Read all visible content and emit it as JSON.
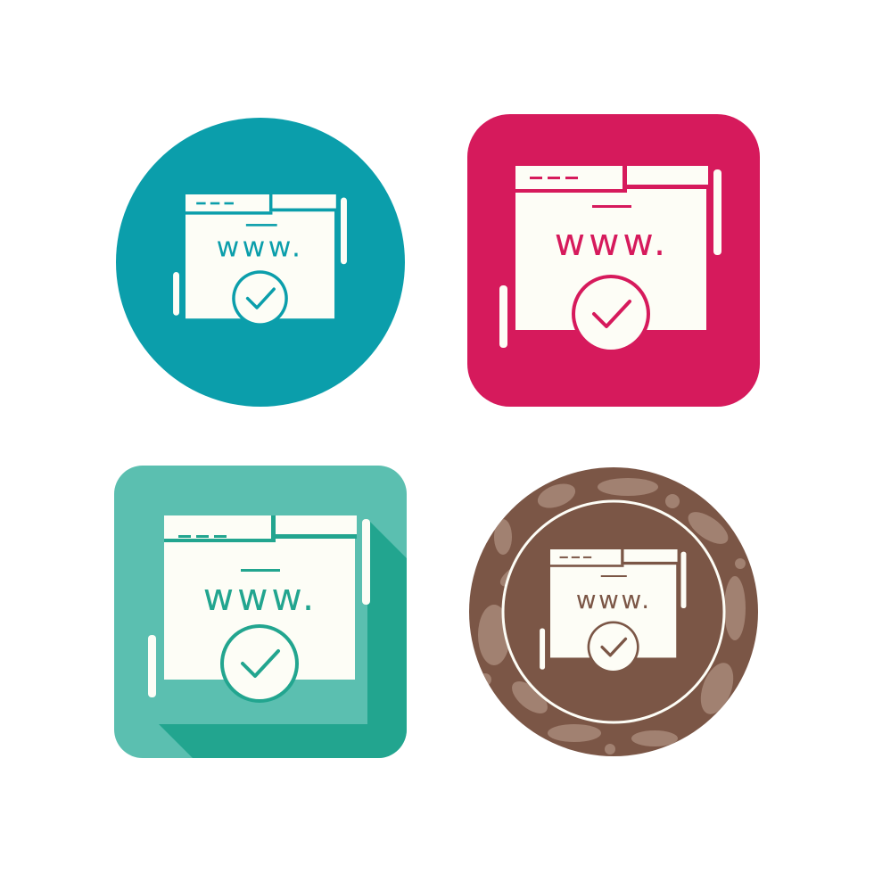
{
  "icons": [
    {
      "name": "web-verified-circle",
      "shape": "circle",
      "background": "#0b9eab",
      "foreground": "#fdfdf6",
      "accent": "#0b9eab",
      "text": "www."
    },
    {
      "name": "web-verified-rounded-square",
      "shape": "rounded-square",
      "background": "#d61a5c",
      "foreground": "#fdfdf6",
      "accent": "#d61a5c",
      "text": "www."
    },
    {
      "name": "web-verified-long-shadow",
      "shape": "rounded-square-long-shadow",
      "background": "#5bbfb0",
      "shadow": "#22a58f",
      "foreground": "#fdfdf6",
      "accent": "#22a58f",
      "text": "www."
    },
    {
      "name": "web-verified-grunge",
      "shape": "grunge-circle",
      "background": "#7b5646",
      "texture": "#a98979",
      "foreground": "#fdfdf6",
      "accent": "#7b5646",
      "text": "www."
    }
  ]
}
